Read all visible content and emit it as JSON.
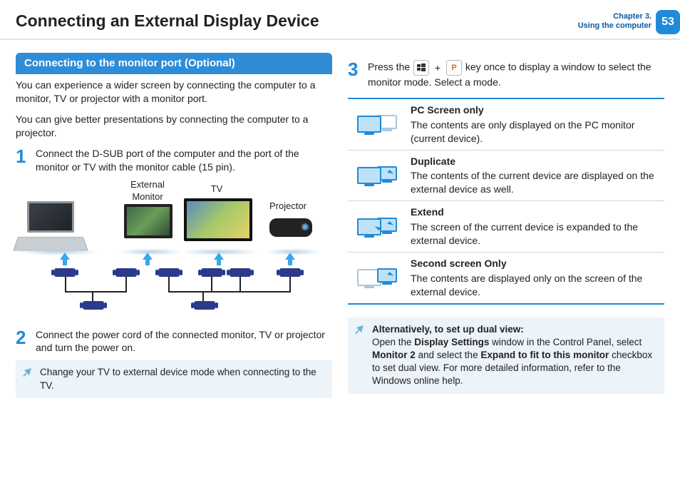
{
  "header": {
    "title": "Connecting an External Display Device",
    "chapter_line1": "Chapter 3.",
    "chapter_line2": "Using the computer",
    "page_number": "53"
  },
  "left": {
    "section_title": "Connecting to the monitor port (Optional)",
    "intro1": "You can experience a wider screen by connecting the computer to a monitor, TV or projector with a monitor port.",
    "intro2": "You can give better presentations by connecting the computer to a projector.",
    "step1_num": "1",
    "step1_text": "Connect the D-SUB port of the computer and the port of the monitor or TV with the monitor cable (15 pin).",
    "label_monitor": "External Monitor",
    "label_tv": "TV",
    "label_projector": "Projector",
    "step2_num": "2",
    "step2_text": "Connect the power cord of the connected monitor, TV or projector and turn the power on.",
    "note": "Change your TV to external device mode when connecting to the TV."
  },
  "right": {
    "step3_num": "3",
    "step3_pre": "Press the ",
    "step3_post": " key once to display a window to select the monitor mode. Select a mode.",
    "plus": "+",
    "p_key": "P",
    "options": [
      {
        "title": "PC Screen only",
        "desc": "The contents are only displayed on the PC monitor (current device)."
      },
      {
        "title": "Duplicate",
        "desc": "The contents of the current device are displayed on the external device as well."
      },
      {
        "title": "Extend",
        "desc": "The screen of the current device is expanded to the external device."
      },
      {
        "title": "Second screen Only",
        "desc": "The contents are displayed only on the screen of the external device."
      }
    ],
    "alt_title": "Alternatively, to set up dual view:",
    "alt_pre": "Open the ",
    "alt_b1": "Display Settings",
    "alt_mid1": " window in the Control Panel, select ",
    "alt_b2": "Monitor 2",
    "alt_mid2": " and select the ",
    "alt_b3": "Expand to fit to this monitor",
    "alt_post": " checkbox to set dual view. For more detailed information, refer to the Windows online help."
  }
}
